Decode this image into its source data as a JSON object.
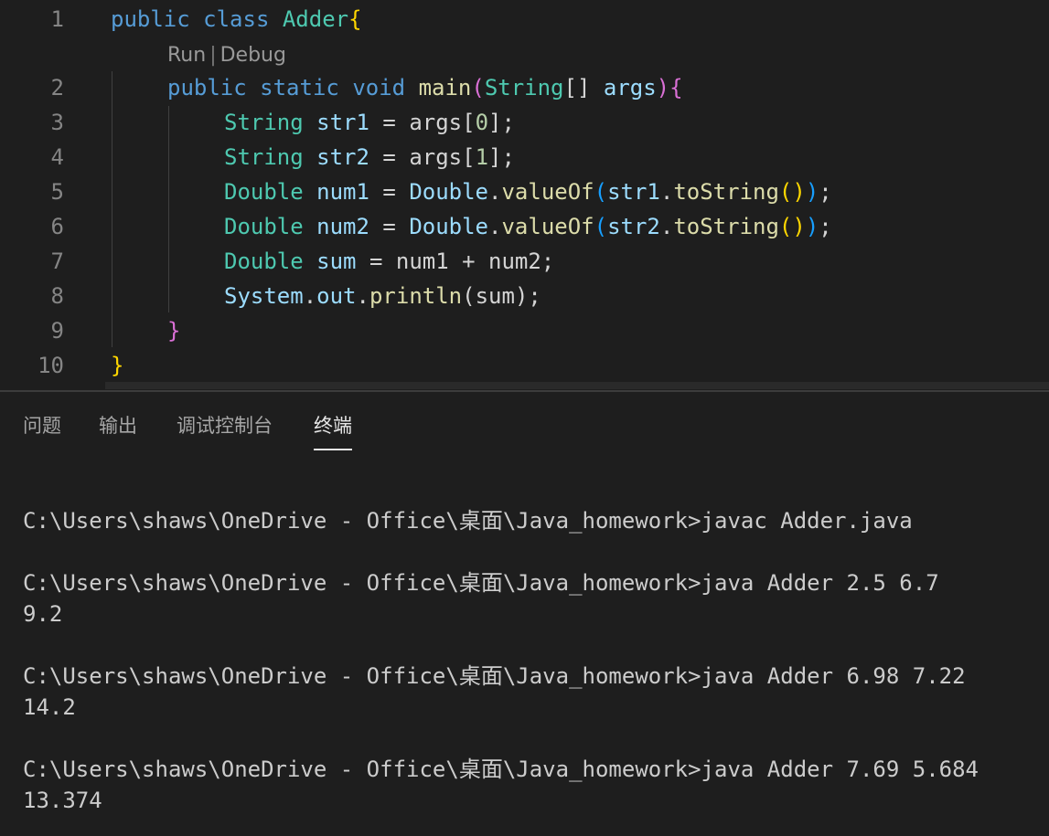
{
  "editor": {
    "line_numbers": [
      "1",
      "2",
      "3",
      "4",
      "5",
      "6",
      "7",
      "8",
      "9",
      "10"
    ],
    "codelens": {
      "run": "Run",
      "separator": "|",
      "debug": "Debug"
    },
    "code": {
      "l1": {
        "kw1": "public",
        "kw2": "class",
        "name": "Adder",
        "brace": "{"
      },
      "l2": {
        "kw1": "public",
        "kw2": "static",
        "kw3": "void",
        "fn": "main",
        "p1": "(",
        "type": "String",
        "arr": "[]",
        "arg": "args",
        "p2": ")",
        "brace": "{"
      },
      "l3": {
        "type": "String",
        "var": "str1",
        "eq": " = ",
        "obj": "args",
        "b1": "[",
        "idx": "0",
        "b2": "]",
        "semi": ";"
      },
      "l4": {
        "type": "String",
        "var": "str2",
        "eq": " = ",
        "obj": "args",
        "b1": "[",
        "idx": "1",
        "b2": "]",
        "semi": ";"
      },
      "l5": {
        "type": "Double",
        "var": "num1",
        "eq": " = ",
        "cls": "Double",
        "dot": ".",
        "fn": "valueOf",
        "p1": "(",
        "arg": "str1",
        "dot2": ".",
        "fn2": "toString",
        "p2": "()",
        "p3": ")",
        "semi": ";"
      },
      "l6": {
        "type": "Double",
        "var": "num2",
        "eq": " = ",
        "cls": "Double",
        "dot": ".",
        "fn": "valueOf",
        "p1": "(",
        "arg": "str2",
        "dot2": ".",
        "fn2": "toString",
        "p2": "()",
        "p3": ")",
        "semi": ";"
      },
      "l7": {
        "type": "Double",
        "var": "sum",
        "rest": " = num1 + num2;"
      },
      "l8": {
        "cls": "System",
        "dot": ".",
        "field": "out",
        "dot2": ".",
        "fn": "println",
        "p1": "(",
        "arg": "sum",
        "p2": ")",
        "semi": ";"
      },
      "l9": {
        "brace": "}"
      },
      "l10": {
        "brace": "}"
      }
    }
  },
  "panel": {
    "tabs": [
      {
        "label": "问题"
      },
      {
        "label": "输出"
      },
      {
        "label": "调试控制台"
      },
      {
        "label": "终端"
      }
    ],
    "active_tab": "终端",
    "terminal_lines": [
      "C:\\Users\\shaws\\OneDrive - Office\\桌面\\Java_homework>javac Adder.java",
      "C:\\Users\\shaws\\OneDrive - Office\\桌面\\Java_homework>java Adder 2.5 6.7",
      "9.2",
      "C:\\Users\\shaws\\OneDrive - Office\\桌面\\Java_homework>java Adder 6.98 7.22",
      "14.2",
      "C:\\Users\\shaws\\OneDrive - Office\\桌面\\Java_homework>java Adder 7.69 5.684",
      "13.374"
    ]
  },
  "colors": {
    "background": "#1e1e1e",
    "keyword": "#569cd6",
    "type": "#4ec9b0",
    "function": "#dcdcaa",
    "variable": "#9cdcfe",
    "number": "#b5cea8",
    "bracket_gold": "#ffd700",
    "bracket_purple": "#da70d6",
    "bracket_blue": "#179fff"
  }
}
